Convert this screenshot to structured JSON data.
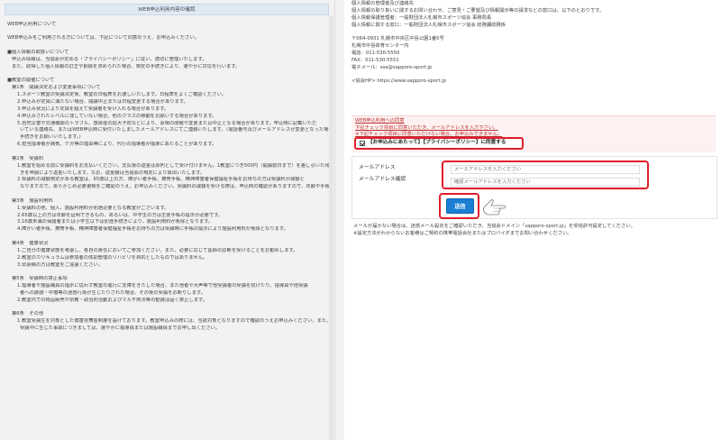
{
  "left": {
    "header": "WEB申込利用内容の確認",
    "lines": [
      {
        "t": "WEB申込利用について",
        "c": ""
      },
      {
        "t": "",
        "c": "gap"
      },
      {
        "t": "WEB申込みをご利用される方については、下記について同意のうえ、お申込みください。",
        "c": ""
      },
      {
        "t": "",
        "c": "gap"
      },
      {
        "t": "■個人情報の取扱いについて",
        "c": ""
      },
      {
        "t": "申込み情報は、当協会が定める「プライバシーポリシー」に従い、適切に管理いたします。",
        "c": "i1"
      },
      {
        "t": "また、取得した個人情報の訂正や削除を求められた場合、規定の手続きにより、速やかに対応を行います。",
        "c": "i1"
      },
      {
        "t": "",
        "c": "gap"
      },
      {
        "t": "■教室の開催について",
        "c": ""
      },
      {
        "t": "第1条　開講決定および変更事項について",
        "c": "i1"
      },
      {
        "t": "1.スポーツ教室の受講決定後、教室の日程表をお渡しいたします。日程表をよくご確認ください。",
        "c": "i2"
      },
      {
        "t": "2.申込みが定員に満たない場合、開講中止または日程変更する場合があります。",
        "c": "i2"
      },
      {
        "t": "3.申込み状況により定員を超えて受講者を受け入れる場合があります。",
        "c": "i2"
      },
      {
        "t": "4.申込みされたレベルに達していない場合、他のクラスの移動をお願いする場合があります。",
        "c": "i2"
      },
      {
        "t": "5.自然災害や交通機関のトラブル、感染症の拡大予防などにより、会場の閉館や変更または中止となる場合があります。申込時に記載いただ",
        "c": "i2"
      },
      {
        "t": "いている連絡先、またはWEB申込時に受付いたしましたメールアドレスにてご連絡いたします。（電話番号及びメールアドレスが変更となった場合、変更",
        "c": "i3"
      },
      {
        "t": "手続きをお願いいたします。）",
        "c": "i3"
      },
      {
        "t": "6.担当指導者が病気、ケガ等の理由等により、代行の指導者が指導にあたることがあります。",
        "c": "i2"
      },
      {
        "t": "",
        "c": "gap"
      },
      {
        "t": "第2条　受講料",
        "c": "i1"
      },
      {
        "t": "1.教室を始める前に受講料をお支払いください。支払後の返金は原則として受け付けません。1教室につき500円（開講前日まで）を差し引いた残額の返金手続",
        "c": "i2"
      },
      {
        "t": "きを申請により返金いたします。なお、返金額は当協会の規定により算出いたします。",
        "c": "i3"
      },
      {
        "t": "2.受講料の減額規定がある教室は、65歳以上の方、障がい者手帳、療育手帳、精神障害者保健福祉手帳をお持ちの方は受講料が減額と",
        "c": "i2"
      },
      {
        "t": "なりますので、あらかじめ必要書類をご確認のうえ、お申込みください。受講料の減額を受ける際は、申込時の確認がありますので、年齢や手帳等の証明となるものをご提示ください。",
        "c": "i3"
      },
      {
        "t": "",
        "c": "gap"
      },
      {
        "t": "第3条　施設利用料",
        "c": "i1"
      },
      {
        "t": "1.受講料の他、個人、施設利用料が別途必要となる教室がございます。",
        "c": "i2"
      },
      {
        "t": "2.65歳以上の方は年齢を証明できるもの、あるいは、中学生の方は生徒手帳の提示が必要です。",
        "c": "i2"
      },
      {
        "t": "3.16歳未満の保護者または小学生以下は別途手続きにより、施設利用料が免除となります。",
        "c": "i2"
      },
      {
        "t": "4.障がい者手帳、療育手帳、精神障害者保健福祉手帳をお持ちの方は受講時に手帳の提示により施設利用料が免除となります。",
        "c": "i2"
      },
      {
        "t": "",
        "c": "gap"
      },
      {
        "t": "第4条　健康状況",
        "c": "i1"
      },
      {
        "t": "1.ご自分の健康状態を考慮し、各自の責任においてご参加ください。また、必要に応じて医師の診断を受けることをお勧めします。",
        "c": "i2"
      },
      {
        "t": "2.教室のカリキュラムは参加者の体調管理のリハビリを目的としたものではありません。",
        "c": "i2"
      },
      {
        "t": "3.伝染病の方は教室をご遠慮ください。",
        "c": "i2"
      },
      {
        "t": "",
        "c": "gap"
      },
      {
        "t": "第5条　受講時の禁止事項",
        "c": "i1"
      },
      {
        "t": "1.指導者や施設職員の指示に従わず教室の進行に支障をきたした場合、また他者や大声等で他受講者の受講を妨げたり、指導員や他受講",
        "c": "i2"
      },
      {
        "t": "者への誹謗・中傷等の迷惑行為が生じたりされた場合、その後の受講をお断りします。",
        "c": "i3"
      },
      {
        "t": "2.教室内での物品販売や宗教・政治的活動およびマルチ商法等の勧誘は固く禁止します。",
        "c": "i2"
      },
      {
        "t": "",
        "c": "gap"
      },
      {
        "t": "第6条　その他",
        "c": "i1"
      },
      {
        "t": "1.教室受講生を対象とした傷害見舞金制度を設けております。教室申込みの際には、当該対象となりますので確認のうえお申込みください。また、教室",
        "c": "i2"
      },
      {
        "t": "受講中に生じた事故につきましては、速やかに指導員または施設職員までお申し出ください。",
        "c": "i3"
      }
    ]
  },
  "right": {
    "contact": [
      {
        "t": "個人情報の管理者及び連絡先",
        "c": ""
      },
      {
        "t": "個人情報の取り扱いに関するお問い合わせ、ご意見・ご要望及び情報開示等の請求などの窓口は、以下のとおりです。",
        "c": ""
      },
      {
        "t": "個人情報保護管理者：一般財団法人札幌市スポーツ協会 事務局長",
        "c": ""
      },
      {
        "t": "個人情報に関する窓口：一般財団法人札幌市スポーツ協会 総務課総務係",
        "c": ""
      },
      {
        "t": "",
        "c": "gap"
      },
      {
        "t": "〒064-0931 札幌市中央区中島公園1番5号",
        "c": ""
      },
      {
        "t": "札幌市中島体育センター内",
        "c": ""
      },
      {
        "t": "電話：011-530-5550",
        "c": ""
      },
      {
        "t": "FAX：011-530-5551",
        "c": ""
      },
      {
        "t": "電子メール：ssa@sapporo-sport.jp",
        "c": ""
      },
      {
        "t": "",
        "c": "gap"
      },
      {
        "t": "<協会HP> https://www.sapporo-sport.jp",
        "c": ""
      }
    ],
    "terms_title": "WEB申込利用への同意",
    "terms_line1": "下記チェック項目に同意いただき、メールアドレスを入力下さい。",
    "terms_line2": "※下記チェック項目に同意いただけない場合、お申込みできません。",
    "agree_label": "【お申込みにあたって】【プライバシーポリシー】に同意する",
    "email_label": "メールアドレス",
    "email_confirm_label": "メールアドレス確認",
    "email_placeholder": "メールアドレスを入力ください",
    "email_confirm_placeholder": "確認メールアドレスを入力ください",
    "send_label": "送信",
    "notice1": "メールが届かない場合は、迷惑メール設定をご確認いただき、当協会ドメイン「sapporo-sport.jp」を受信許可設定してください。",
    "notice2": "※設定方法がわからないお客様はご契約の携帯電話会社またはプロバイダまでお問い合わせください。"
  }
}
